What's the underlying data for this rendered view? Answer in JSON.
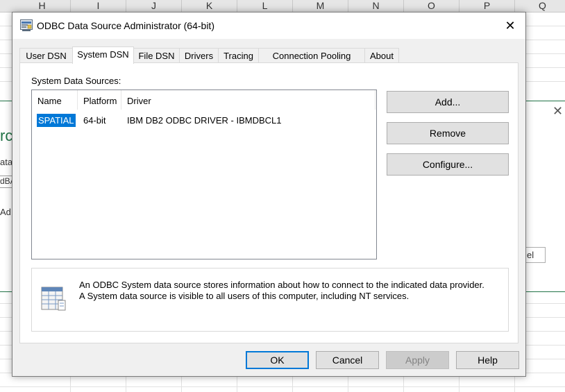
{
  "spreadsheet": {
    "columns": [
      "H",
      "I",
      "J",
      "K",
      "L",
      "M",
      "N",
      "O",
      "P",
      "Q"
    ],
    "fragments": {
      "big": "rc",
      "line1": "ata",
      "line2": "dBA",
      "line3": "Ad",
      "button": "el"
    }
  },
  "dialog": {
    "title": "ODBC Data Source Administrator (64-bit)",
    "close_glyph": "✕",
    "tabs": [
      "User DSN",
      "System DSN",
      "File DSN",
      "Drivers",
      "Tracing",
      "Connection Pooling",
      "About"
    ],
    "active_tab": "System DSN",
    "section_label": "System Data Sources:",
    "list": {
      "columns": [
        "Name",
        "Platform",
        "Driver"
      ],
      "rows": [
        {
          "name": "SPATIAL",
          "platform": "64-bit",
          "driver": "IBM DB2 ODBC DRIVER - IBMDBCL1"
        }
      ]
    },
    "side_buttons": {
      "add": "Add...",
      "remove": "Remove",
      "configure": "Configure..."
    },
    "info": {
      "line1": "An ODBC System data source stores information about how to connect to the indicated data provider.",
      "line2": "A System data source is visible to all users of this computer, including NT services."
    },
    "footer_buttons": {
      "ok": "OK",
      "cancel": "Cancel",
      "apply": "Apply",
      "help": "Help"
    }
  },
  "colors": {
    "accent": "#0078d7",
    "sheet_green": "#217346",
    "dialog_bg": "#f0f0f0"
  }
}
